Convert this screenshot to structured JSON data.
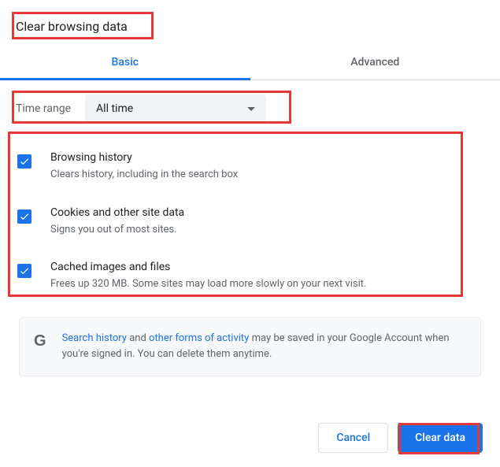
{
  "title": "Clear browsing data",
  "tabs": {
    "basic": "Basic",
    "advanced": "Advanced"
  },
  "time_range": {
    "label": "Time range",
    "value": "All time"
  },
  "items": [
    {
      "title": "Browsing history",
      "desc": "Clears history, including in the search box"
    },
    {
      "title": "Cookies and other site data",
      "desc": "Signs you out of most sites."
    },
    {
      "title": "Cached images and files",
      "desc": "Frees up 320 MB. Some sites may load more slowly on your next visit."
    }
  ],
  "info": {
    "link1": "Search history",
    "mid1": " and ",
    "link2": "other forms of activity",
    "rest": " may be saved in your Google Account when you're signed in. You can delete them anytime."
  },
  "buttons": {
    "cancel": "Cancel",
    "clear": "Clear data"
  }
}
